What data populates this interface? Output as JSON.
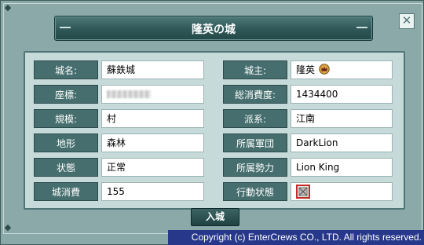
{
  "dialog": {
    "title": "隆英の城",
    "close_label": "✕"
  },
  "left_fields": [
    {
      "label": "城名:",
      "value": "蘇鉄城"
    },
    {
      "label": "座標:",
      "value": ""
    },
    {
      "label": "規模:",
      "value": "村"
    },
    {
      "label": "地形",
      "value": "森林"
    },
    {
      "label": "状態",
      "value": "正常"
    },
    {
      "label": "城消費",
      "value": "155"
    }
  ],
  "right_fields": [
    {
      "label": "城主:",
      "value": "隆英"
    },
    {
      "label": "総消費度:",
      "value": "1434400"
    },
    {
      "label": "派系:",
      "value": "江南"
    },
    {
      "label": "所属軍団",
      "value": "DarkLion"
    },
    {
      "label": "所属勢力",
      "value": "Lion King"
    },
    {
      "label": "行動状態",
      "value": ""
    }
  ],
  "enter_button": "入城",
  "copyright": "Copyright (c) EnterCrews CO., LTD. All rights reserved.",
  "icons": {
    "owner_badge": "crown-icon",
    "action_state": "disabled-status-icon",
    "close": "close-icon"
  }
}
